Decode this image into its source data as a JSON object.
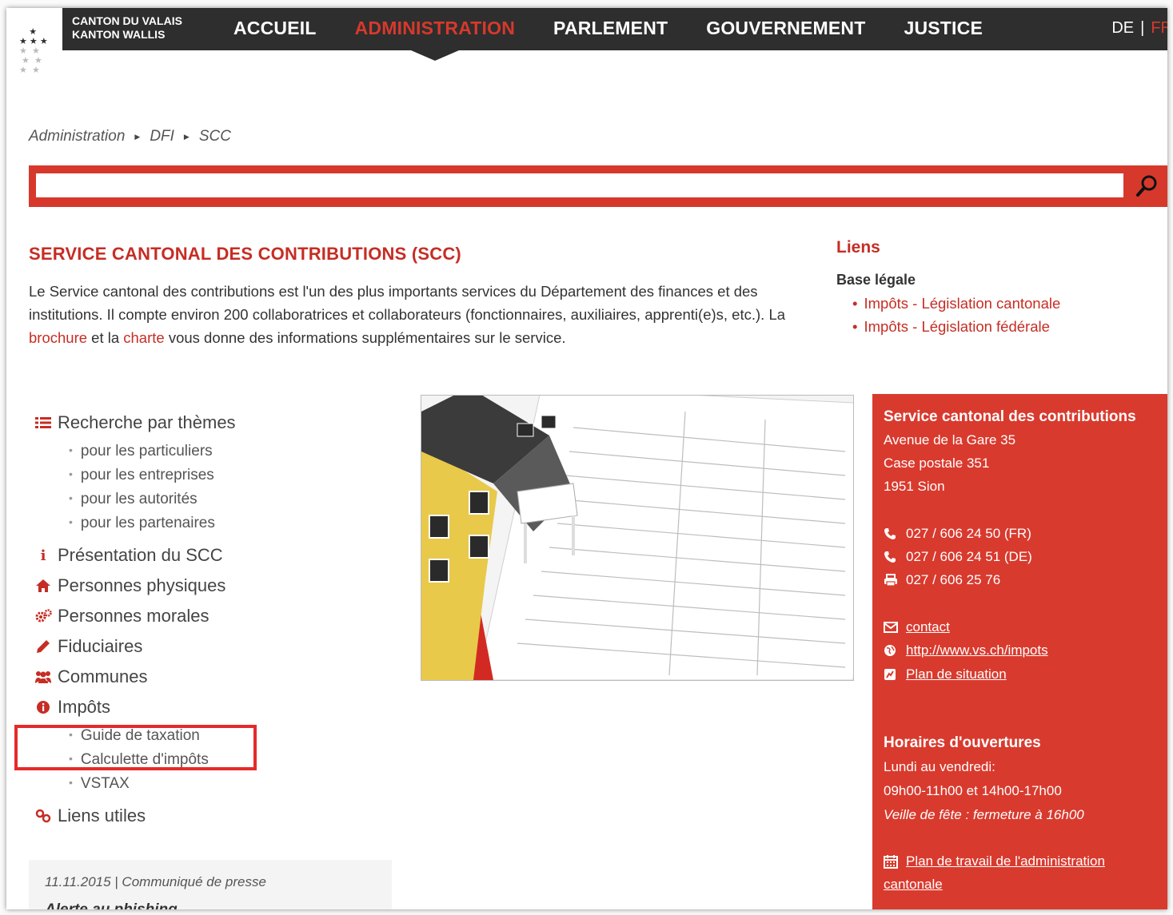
{
  "header": {
    "logo_line1": "CANTON DU VALAIS",
    "logo_line2": "KANTON WALLIS",
    "nav": [
      {
        "label": "ACCUEIL",
        "active": false
      },
      {
        "label": "ADMINISTRATION",
        "active": true
      },
      {
        "label": "PARLEMENT",
        "active": false
      },
      {
        "label": "GOUVERNEMENT",
        "active": false
      },
      {
        "label": "JUSTICE",
        "active": false
      }
    ],
    "lang_de": "DE",
    "lang_sep": "|",
    "lang_fr": "FR"
  },
  "breadcrumb": [
    "Administration",
    "DFI",
    "SCC"
  ],
  "search": {
    "value": "",
    "placeholder": ""
  },
  "intro": {
    "title": "SERVICE CANTONAL DES CONTRIBUTIONS (SCC)",
    "text_1": "Le Service cantonal des contributions est l'un des plus importants services du Département des finances et des institutions. Il compte environ 200 collaboratrices et collaborateurs (fonctionnaires, auxiliaires, apprenti(e)s, etc.). La",
    "link_brochure": "brochure",
    "text_2": "et la",
    "link_charte": "charte",
    "text_3": "vous donne des informations supplémentaires sur le service."
  },
  "liens": {
    "title": "Liens",
    "subtitle": "Base légale",
    "items": [
      "Impôts - Législation cantonale",
      "Impôts - Législation fédérale"
    ]
  },
  "menu": {
    "recherche": "Recherche par thèmes",
    "recherche_items": [
      "pour les particuliers",
      "pour les entreprises",
      "pour les autorités",
      "pour les partenaires"
    ],
    "presentation": "Présentation du SCC",
    "physiques": "Personnes physiques",
    "morales": "Personnes morales",
    "fiduciaires": "Fiduciaires",
    "communes": "Communes",
    "impots": "Impôts",
    "impots_items": [
      "Guide de taxation",
      "Calculette d'impôts",
      "VSTAX"
    ],
    "liens_utiles": "Liens utiles"
  },
  "news": {
    "date": "11.11.2015 | Communiqué de presse",
    "title": "Alerte au phishing"
  },
  "contact": {
    "title": "Service cantonal des contributions",
    "address1": "Avenue de la Gare 35",
    "address2": "Case postale 351",
    "address3": "1951 Sion",
    "phone_fr": "027 / 606 24 50 (FR)",
    "phone_de": "027 / 606 24 51 (DE)",
    "fax": "027 / 606 25 76",
    "email": "contact",
    "website": "http://www.vs.ch/impots",
    "map": "Plan de situation",
    "hours_title": "Horaires d'ouvertures",
    "hours_days": "Lundi au vendredi:",
    "hours_time": "09h00-11h00 et 14h00-17h00",
    "hours_note": "Veille de fête : fermeture à 16h00",
    "plan_line1": "Plan de travail de l'administration",
    "plan_line2": "cantonale"
  },
  "colors": {
    "brand_red": "#d6392c",
    "topbar": "#2e2e2e",
    "highlight": "#e52a2a"
  }
}
